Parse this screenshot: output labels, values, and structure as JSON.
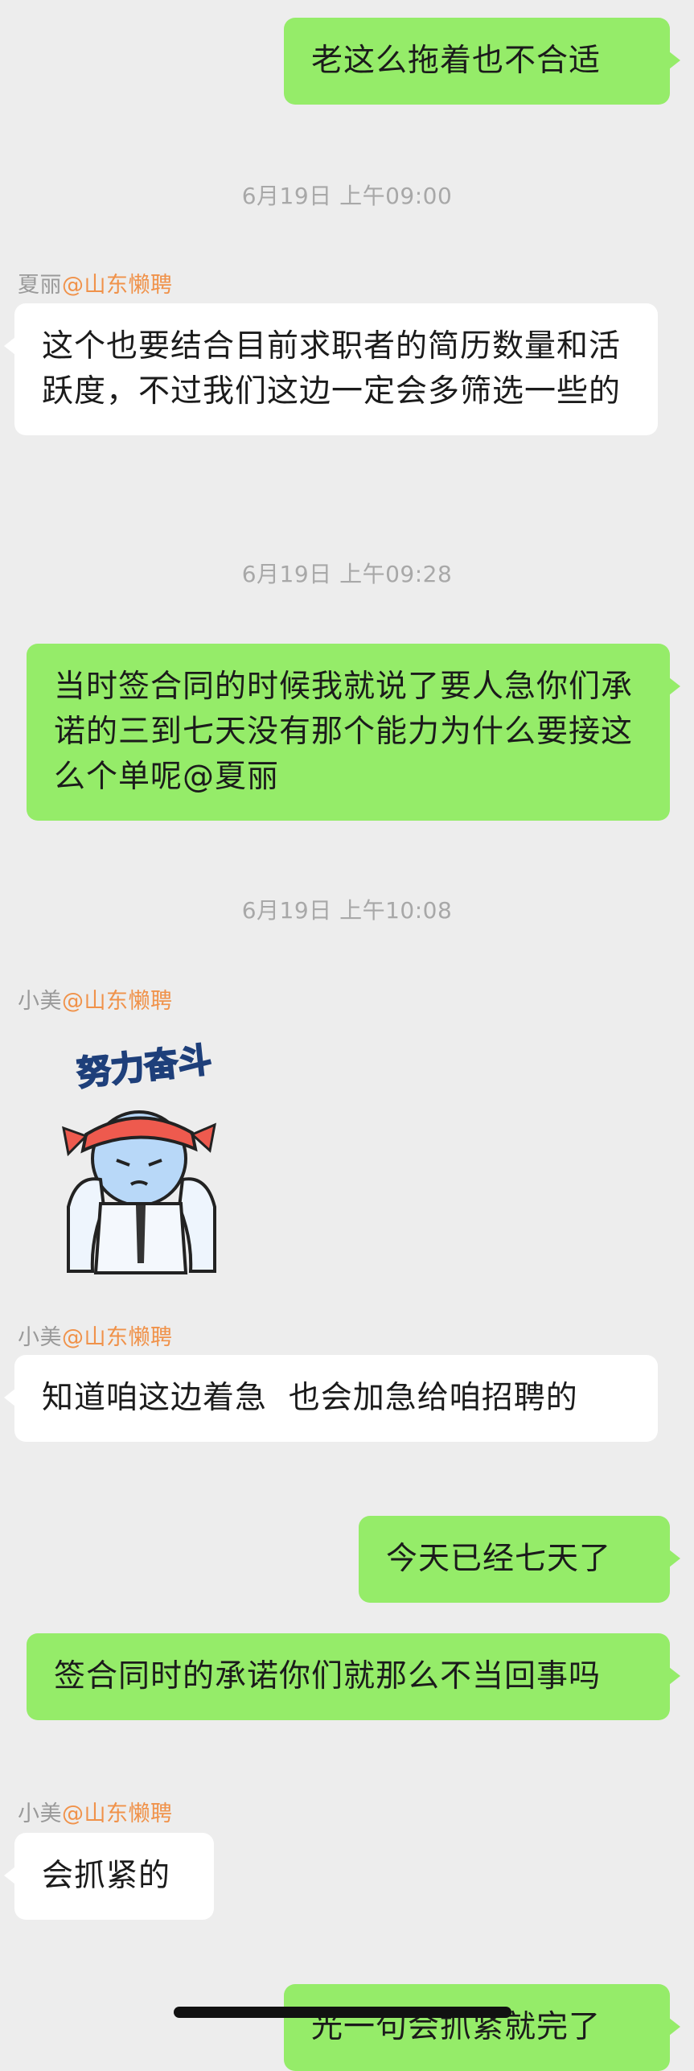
{
  "messages": [
    {
      "id": "m1",
      "text": "老这么拖着也不合适"
    },
    {
      "ts": "6月19日 上午09:00"
    },
    {
      "id": "m2",
      "sender": "夏丽",
      "org": "@山东懒聘",
      "text": "这个也要结合目前求职者的简历数量和活跃度，不过我们这边一定会多筛选一些的"
    },
    {
      "ts": "6月19日 上午09:28"
    },
    {
      "id": "m3",
      "text": "当时签合同的时候我就说了要人急你们承诺的三到七天没有那个能力为什么要接这么个单呢@夏丽"
    },
    {
      "ts": "6月19日 上午10:08"
    },
    {
      "id": "m4",
      "sender": "小美",
      "org": "@山东懒聘",
      "sticker_text": "努力奋斗"
    },
    {
      "id": "m5",
      "sender": "小美",
      "org": "@山东懒聘",
      "text": "知道咱这边着急  也会加急给咱招聘的"
    },
    {
      "id": "m6",
      "text": "今天已经七天了"
    },
    {
      "id": "m7",
      "text": "签合同时的承诺你们就那么不当回事吗"
    },
    {
      "id": "m8",
      "sender": "小美",
      "org": "@山东懒聘",
      "text": "会抓紧的"
    },
    {
      "id": "m9",
      "text": "光一句会抓紧就完了"
    }
  ],
  "colors": {
    "outgoing": "#95ec69",
    "incoming": "#ffffff",
    "background": "#ededed",
    "org": "#f0924a"
  }
}
